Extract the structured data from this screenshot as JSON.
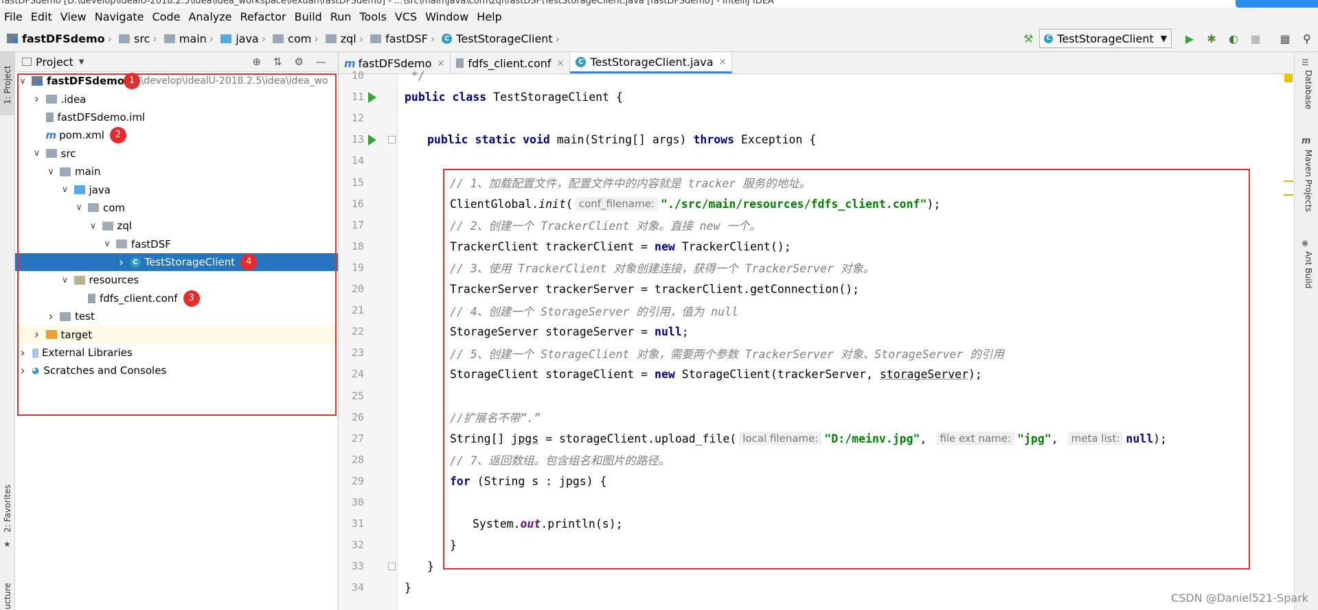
{
  "window": {
    "title": "fastDFSdemo [D:\\develop\\idealU-2018.2.5\\idea\\idea_workspace\\lexuan\\fastDFSdemo] - ...\\src\\main\\java\\com\\zql\\fastDSF\\TestStorageClient.java [fastDFSdemo] - IntelliJ IDEA"
  },
  "menu": [
    "File",
    "Edit",
    "View",
    "Navigate",
    "Code",
    "Analyze",
    "Refactor",
    "Build",
    "Run",
    "Tools",
    "VCS",
    "Window",
    "Help"
  ],
  "breadcrumb": [
    "fastDFSdemo",
    "src",
    "main",
    "java",
    "com",
    "zql",
    "fastDSF",
    "TestStorageClient"
  ],
  "toolbar": {
    "run_config": "TestStorageClient",
    "icons": [
      "build-hammer-icon",
      "run-icon",
      "debug-icon",
      "coverage-icon",
      "stop-icon",
      "project-structure-icon",
      "search-icon"
    ]
  },
  "project_panel": {
    "title": "Project",
    "tree": [
      {
        "label": "fastDFSdemo",
        "path": "D:\\develop\\idealU-2018.2.5\\idea\\idea_wo",
        "depth": 0,
        "arrow": "down",
        "icon": "module",
        "badge": "1",
        "bold": true
      },
      {
        "label": ".idea",
        "depth": 1,
        "arrow": "right",
        "icon": "folder"
      },
      {
        "label": "fastDFSdemo.iml",
        "depth": 1,
        "arrow": "",
        "icon": "file"
      },
      {
        "label": "pom.xml",
        "depth": 1,
        "arrow": "",
        "icon": "maven",
        "badge": "2"
      },
      {
        "label": "src",
        "depth": 1,
        "arrow": "down",
        "icon": "folder"
      },
      {
        "label": "main",
        "depth": 2,
        "arrow": "down",
        "icon": "folder"
      },
      {
        "label": "java",
        "depth": 3,
        "arrow": "down",
        "icon": "folder-blue"
      },
      {
        "label": "com",
        "depth": 4,
        "arrow": "down",
        "icon": "package"
      },
      {
        "label": "zql",
        "depth": 5,
        "arrow": "down",
        "icon": "package"
      },
      {
        "label": "fastDSF",
        "depth": 6,
        "arrow": "down",
        "icon": "package"
      },
      {
        "label": "TestStorageClient",
        "depth": 7,
        "arrow": "right",
        "icon": "class",
        "badge": "4",
        "selected": true
      },
      {
        "label": "resources",
        "depth": 3,
        "arrow": "down",
        "icon": "folder-res"
      },
      {
        "label": "fdfs_client.conf",
        "depth": 4,
        "arrow": "",
        "icon": "conf",
        "badge": "3"
      },
      {
        "label": "test",
        "depth": 2,
        "arrow": "right",
        "icon": "folder"
      },
      {
        "label": "target",
        "depth": 1,
        "arrow": "right",
        "icon": "folder-orange",
        "hl": true
      },
      {
        "label": "External Libraries",
        "depth": 0,
        "arrow": "right",
        "icon": "libs"
      },
      {
        "label": "Scratches and Consoles",
        "depth": 0,
        "arrow": "right",
        "icon": "scratch"
      }
    ]
  },
  "left_strip": {
    "project": "1: Project",
    "favorites": "2: Favorites",
    "structure": "ucture"
  },
  "right_strip": {
    "database": "Database",
    "maven": "Maven Projects",
    "ant": "Ant Build"
  },
  "tabs": [
    {
      "label": "fastDFSdemo",
      "icon": "maven",
      "active": false
    },
    {
      "label": "fdfs_client.conf",
      "icon": "conf",
      "active": false
    },
    {
      "label": "TestStorageClient.java",
      "icon": "class",
      "active": true
    }
  ],
  "code": [
    {
      "n": "10",
      "indent": 0,
      "parts": [
        {
          "t": " */",
          "c": "cmt"
        }
      ]
    },
    {
      "n": "11",
      "indent": 0,
      "run": true,
      "parts": [
        {
          "t": "public class ",
          "c": "kw"
        },
        {
          "t": "TestStorageClient {"
        }
      ]
    },
    {
      "n": "12",
      "indent": 0,
      "parts": []
    },
    {
      "n": "13",
      "indent": 1,
      "run": true,
      "fold": true,
      "parts": [
        {
          "t": "public static void ",
          "c": "kw"
        },
        {
          "t": "main(String[] args) "
        },
        {
          "t": "throws ",
          "c": "kw"
        },
        {
          "t": "Exception {"
        }
      ]
    },
    {
      "n": "14",
      "indent": 0,
      "parts": []
    },
    {
      "n": "15",
      "indent": 2,
      "parts": [
        {
          "t": "// 1、加载配置文件，配置文件中的内容就是 tracker 服务的地址。",
          "c": "cmt"
        }
      ]
    },
    {
      "n": "16",
      "indent": 2,
      "parts": [
        {
          "t": "ClientGlobal."
        },
        {
          "t": "init",
          "c": "it"
        },
        {
          "t": "("
        },
        {
          "h": "conf_filename:"
        },
        {
          "t": "\"./src/main/resources/fdfs_client.conf\"",
          "c": "str"
        },
        {
          "t": ");"
        }
      ]
    },
    {
      "n": "17",
      "indent": 2,
      "parts": [
        {
          "t": "// 2、创建一个 TrackerClient 对象。直接 new 一个。",
          "c": "cmt"
        }
      ]
    },
    {
      "n": "18",
      "indent": 2,
      "parts": [
        {
          "t": "TrackerClient trackerClient = "
        },
        {
          "t": "new ",
          "c": "kw"
        },
        {
          "t": "TrackerClient();"
        }
      ]
    },
    {
      "n": "19",
      "indent": 2,
      "parts": [
        {
          "t": "// 3、使用 TrackerClient 对象创建连接，获得一个 TrackerServer 对象。",
          "c": "cmt"
        }
      ]
    },
    {
      "n": "20",
      "indent": 2,
      "parts": [
        {
          "t": "TrackerServer trackerServer = trackerClient.getConnection();"
        }
      ]
    },
    {
      "n": "21",
      "indent": 2,
      "parts": [
        {
          "t": "// 4、创建一个 StorageServer 的引用，值为 null",
          "c": "cmt"
        }
      ]
    },
    {
      "n": "22",
      "indent": 2,
      "parts": [
        {
          "t": "StorageServer storageServer = "
        },
        {
          "t": "null",
          "c": "kw"
        },
        {
          "t": ";"
        }
      ]
    },
    {
      "n": "23",
      "indent": 2,
      "parts": [
        {
          "t": "// 5、创建一个 StorageClient 对象，需要两个参数 TrackerServer 对象、StorageServer 的引用",
          "c": "cmt"
        }
      ]
    },
    {
      "n": "24",
      "indent": 2,
      "parts": [
        {
          "t": "StorageClient storageClient = "
        },
        {
          "t": "new ",
          "c": "kw"
        },
        {
          "t": "StorageClient(trackerServer, "
        },
        {
          "t": "storageServer",
          "c": "ul"
        },
        {
          "t": ");"
        }
      ]
    },
    {
      "n": "25",
      "indent": 0,
      "parts": []
    },
    {
      "n": "26",
      "indent": 2,
      "parts": [
        {
          "t": "//扩展名不带“.”",
          "c": "cmt"
        }
      ]
    },
    {
      "n": "27",
      "indent": 2,
      "parts": [
        {
          "t": "String[] "
        },
        {
          "t": "jpgs",
          "c": "ul"
        },
        {
          "t": " = storageClient.upload_file("
        },
        {
          "h": "local filename:"
        },
        {
          "t": "\"D:/meinv.jpg\"",
          "c": "str"
        },
        {
          "t": ", "
        },
        {
          "h": "file ext name:"
        },
        {
          "t": "\"jpg\"",
          "c": "str"
        },
        {
          "t": ", "
        },
        {
          "h": "meta list:"
        },
        {
          "t": "null",
          "c": "kw"
        },
        {
          "t": ");"
        }
      ]
    },
    {
      "n": "28",
      "indent": 2,
      "parts": [
        {
          "t": "// 7、返回数组。包含组名和图片的路径。",
          "c": "cmt"
        }
      ]
    },
    {
      "n": "29",
      "indent": 2,
      "parts": [
        {
          "t": "for ",
          "c": "kw"
        },
        {
          "t": "(String s : jpgs) {"
        }
      ]
    },
    {
      "n": "30",
      "indent": 0,
      "parts": []
    },
    {
      "n": "31",
      "indent": 3,
      "parts": [
        {
          "t": "System."
        },
        {
          "t": "out",
          "c": "fld"
        },
        {
          "t": ".println(s);"
        }
      ]
    },
    {
      "n": "32",
      "indent": 2,
      "parts": [
        {
          "t": "}"
        }
      ]
    },
    {
      "n": "33",
      "indent": 1,
      "fold": true,
      "parts": [
        {
          "t": "}"
        }
      ]
    },
    {
      "n": "34",
      "indent": 0,
      "parts": [
        {
          "t": "}"
        }
      ]
    }
  ],
  "watermark": "CSDN @Daniel521-Spark",
  "colors": {
    "selection": "#2675bf",
    "annotation_red": "#e03030",
    "keyword": "#000080",
    "string": "#008000",
    "comment": "#808080"
  }
}
